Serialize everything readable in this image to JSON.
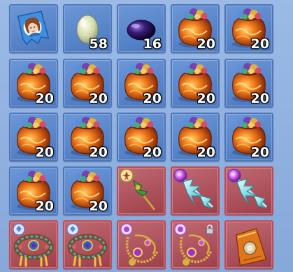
{
  "inventory": {
    "rows": [
      [
        {
          "item": "portrait-card",
          "qty": "",
          "rarity": "common"
        },
        {
          "item": "pale-green-egg",
          "qty": "58",
          "rarity": "common"
        },
        {
          "item": "dark-purple-gem",
          "qty": "16",
          "rarity": "common"
        },
        {
          "item": "orange-treasure-bag",
          "qty": "20",
          "rarity": "common"
        },
        {
          "item": "orange-treasure-bag",
          "qty": "20",
          "rarity": "common"
        }
      ],
      [
        {
          "item": "orange-treasure-bag",
          "qty": "20",
          "rarity": "common"
        },
        {
          "item": "orange-treasure-bag",
          "qty": "20",
          "rarity": "common"
        },
        {
          "item": "orange-treasure-bag",
          "qty": "20",
          "rarity": "common"
        },
        {
          "item": "orange-treasure-bag",
          "qty": "20",
          "rarity": "common"
        },
        {
          "item": "orange-treasure-bag",
          "qty": "20",
          "rarity": "common"
        }
      ],
      [
        {
          "item": "orange-treasure-bag",
          "qty": "20",
          "rarity": "common"
        },
        {
          "item": "orange-treasure-bag",
          "qty": "20",
          "rarity": "common"
        },
        {
          "item": "orange-treasure-bag",
          "qty": "20",
          "rarity": "common"
        },
        {
          "item": "orange-treasure-bag",
          "qty": "20",
          "rarity": "common"
        },
        {
          "item": "orange-treasure-bag",
          "qty": "20",
          "rarity": "common"
        }
      ],
      [
        {
          "item": "orange-treasure-bag",
          "qty": "20",
          "rarity": "common"
        },
        {
          "item": "orange-treasure-bag",
          "qty": "20",
          "rarity": "common"
        },
        {
          "item": "green-gold-wand",
          "qty": "",
          "rarity": "rare"
        },
        {
          "item": "ice-crystal-staff",
          "qty": "",
          "rarity": "rare"
        },
        {
          "item": "ice-crystal-staff",
          "qty": "",
          "rarity": "rare"
        }
      ],
      [
        {
          "item": "jeweled-wreath",
          "qty": "",
          "rarity": "rare"
        },
        {
          "item": "jeweled-wreath",
          "qty": "",
          "rarity": "rare"
        },
        {
          "item": "golden-purple-necklace",
          "qty": "",
          "rarity": "rare"
        },
        {
          "item": "golden-purple-necklace-locked",
          "qty": "",
          "rarity": "rare"
        },
        {
          "item": "orange-pouch",
          "qty": "",
          "rarity": "rare"
        }
      ]
    ]
  },
  "colors": {
    "common_slot": "#5a86c9",
    "rare_slot": "#b0525c",
    "background": "#8fb0de"
  }
}
